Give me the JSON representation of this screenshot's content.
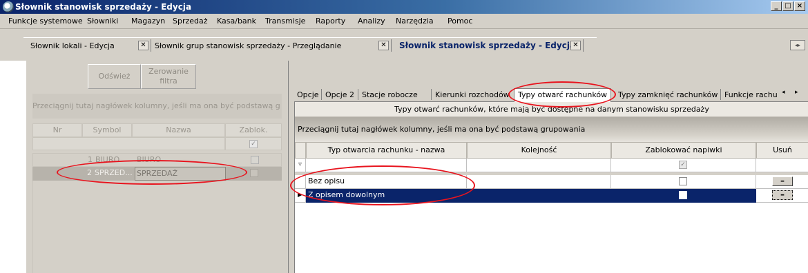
{
  "window": {
    "title": "Słownik stanowisk sprzedaży - Edycja",
    "controls": [
      "_",
      "□",
      "×"
    ]
  },
  "menu": [
    "Funkcje systemowe",
    "Słowniki",
    "Magazyn",
    "Sprzedaż",
    "Kasa/bank",
    "Transmisje",
    "Raporty",
    "Analizy",
    "Narzędzia",
    "Pomoc"
  ],
  "doc_tabs": [
    {
      "label": "Słownik lokali - Edycja",
      "active": false
    },
    {
      "label": "Słownik grup stanowisk sprzedaży - Przeglądanie",
      "active": false
    },
    {
      "label": "Słownik stanowisk sprzedaży - Edycja",
      "active": true
    }
  ],
  "left": {
    "refresh": "Odśwież",
    "reset_filter_line1": "Zerowanie",
    "reset_filter_line2": "filtra",
    "group_hint": "Przeciągnij tutaj nagłówek kolumny, jeśli ma ona być podstawą g",
    "columns": [
      "Nr",
      "Symbol",
      "Nazwa",
      "Zablok."
    ],
    "rows": [
      {
        "nr": "1",
        "symbol": "BIURO",
        "nazwa": "BIURO",
        "zablok": false
      },
      {
        "nr": "2",
        "symbol": "SPRZED...",
        "nazwa": "SPRZEDAŻ",
        "zablok": false
      }
    ]
  },
  "right": {
    "tabs": [
      "Opcje",
      "Opcje 2",
      "Stacje robocze",
      "Kierunki rozchodów",
      "Typy otwarć rachunków",
      "Typy zamknięć rachunków",
      "Funkcje rachu"
    ],
    "active_tab": "Typy otwarć rachunków",
    "caption": "Typy otwarć rachunków, które mają być dostępne na danym stanowisku sprzedaży",
    "group_hint": "Przeciągnij tutaj nagłówek kolumny, jeśli ma ona być podstawą grupowania",
    "columns": [
      "Typ otwarcia rachunku - nazwa",
      "Kolejność",
      "Zablokować napiwki",
      "Usuń"
    ],
    "rows": [
      {
        "name": "Bez opisu",
        "order": "",
        "block_tips": false,
        "selected": false
      },
      {
        "name": "Z opisem dowolnym",
        "order": "",
        "block_tips": false,
        "selected": true
      }
    ],
    "remove_label": "–"
  },
  "colors": {
    "annotation": "#e8141e",
    "selection": "#0a246a",
    "chrome": "#d4d0c8"
  }
}
